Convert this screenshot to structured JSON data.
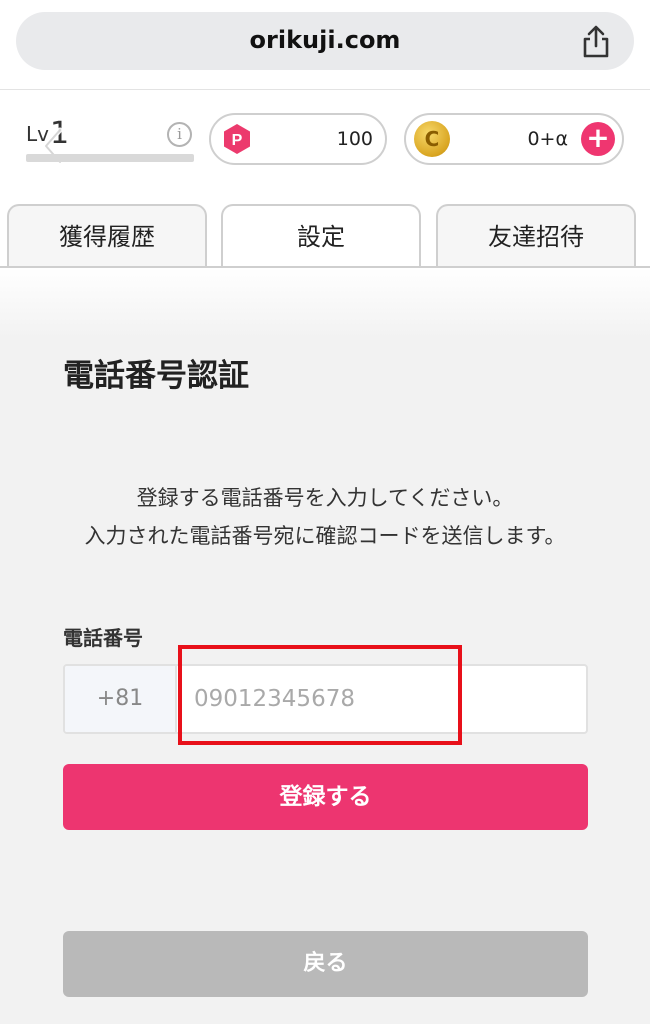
{
  "browser": {
    "url": "orikuji.com"
  },
  "status": {
    "level_label": "Lv",
    "level_value": "1",
    "points_badge": "P",
    "points_value": "100",
    "coin_badge": "C",
    "coin_value": "0+α",
    "plus_label": "+"
  },
  "tabs": [
    {
      "label": "獲得履歴"
    },
    {
      "label": "設定"
    },
    {
      "label": "友達招待"
    }
  ],
  "main": {
    "title": "電話番号認証",
    "description_line1": "登録する電話番号を入力してください。",
    "description_line2": "入力された電話番号宛に確認コードを送信します。",
    "phone_label": "電話番号",
    "country_code": "+81",
    "phone_placeholder": "09012345678",
    "phone_value": "",
    "register_button": "登録する",
    "back_button": "戻る"
  },
  "colors": {
    "accent": "#ed3570",
    "disabled": "#b9b9b9",
    "highlight": "#e8101a"
  }
}
